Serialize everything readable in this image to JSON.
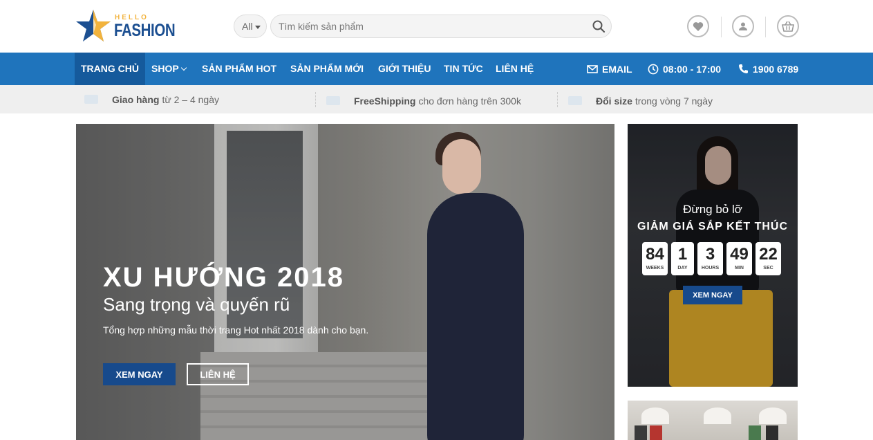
{
  "header": {
    "logo_small": "HELLO",
    "logo_big": "FASHION",
    "search_category": "All",
    "search_placeholder": "Tìm kiếm sản phẩm"
  },
  "nav": {
    "items": [
      {
        "label": "Trang chủ",
        "active": true
      },
      {
        "label": "Shop",
        "has_dropdown": true
      },
      {
        "label": "Sản phẩm hot"
      },
      {
        "label": "Sản phẩm mới"
      },
      {
        "label": "Giới thiệu"
      },
      {
        "label": "Tin tức"
      },
      {
        "label": "Liên hệ"
      }
    ],
    "email_label": "EMAIL",
    "hours_label": "08:00 - 17:00",
    "phone_label": "1900 6789"
  },
  "perks": [
    {
      "bold": "Giao hàng",
      "text": "từ 2 – 4 ngày"
    },
    {
      "bold": "FreeShipping",
      "text": "cho đơn hàng trên 300k"
    },
    {
      "bold": "Đổi size",
      "text": "trong vòng 7 ngày"
    }
  ],
  "hero": {
    "title": "XU HƯỚNG 2018",
    "subtitle": "Sang trọng và quyến rũ",
    "description": "Tổng hợp những mẫu thời trang Hot nhất 2018 dành cho bạn.",
    "primary_button": "Xem ngay",
    "secondary_button": "Liên hệ"
  },
  "promo": {
    "pretitle": "Đừng bỏ lỡ",
    "title": "GIẢM GIÁ SẮP KẾT THÚC",
    "countdown": [
      {
        "value": "84",
        "label": "Weeks"
      },
      {
        "value": "1",
        "label": "Day"
      },
      {
        "value": "3",
        "label": "Hours"
      },
      {
        "value": "49",
        "label": "Min"
      },
      {
        "value": "22",
        "label": "Sec"
      }
    ],
    "button": "Xem ngay"
  },
  "colors": {
    "nav_bg": "#1f74bc",
    "nav_active": "#155a9c",
    "button_primary": "#174a8c",
    "logo_blue": "#1c4f91",
    "logo_gold": "#f2b33d"
  }
}
